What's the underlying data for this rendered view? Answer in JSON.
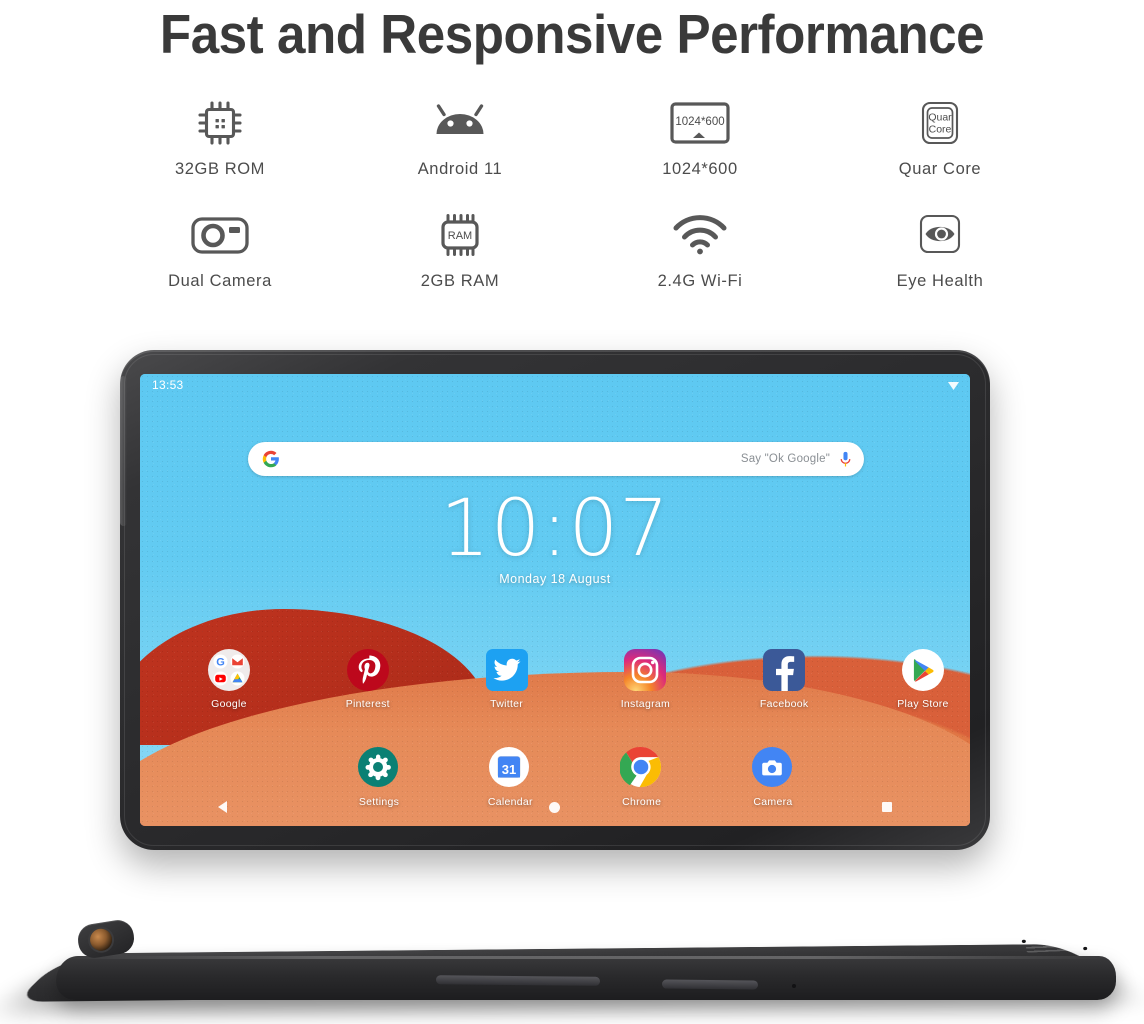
{
  "headline": "Fast and Responsive Performance",
  "features": [
    {
      "icon": "cpu-chip-icon",
      "label": "32GB ROM"
    },
    {
      "icon": "android-robot-icon",
      "label": "Android 11"
    },
    {
      "icon": "display-resolution-icon",
      "label": "1024*600",
      "icon_text": "1024*600"
    },
    {
      "icon": "quad-core-icon",
      "label": "Quar Core",
      "icon_text_line1": "Quar",
      "icon_text_line2": "Core"
    },
    {
      "icon": "camera-icon",
      "label": "Dual Camera"
    },
    {
      "icon": "ram-chip-icon",
      "label": "2GB RAM",
      "icon_text": "RAM"
    },
    {
      "icon": "wifi-icon",
      "label": "2.4G Wi-Fi"
    },
    {
      "icon": "eye-icon",
      "label": "Eye Health"
    }
  ],
  "tablet": {
    "statusbar": {
      "time": "13:53"
    },
    "search": {
      "hint": "Say \"Ok Google\""
    },
    "clock_widget": {
      "time": "10:07",
      "date": "Monday 18 August"
    },
    "apps_row1": [
      {
        "name": "Google",
        "icon": "google-folder-icon"
      },
      {
        "name": "Pinterest",
        "icon": "pinterest-icon"
      },
      {
        "name": "Twitter",
        "icon": "twitter-icon"
      },
      {
        "name": "Instagram",
        "icon": "instagram-icon"
      },
      {
        "name": "Facebook",
        "icon": "facebook-icon"
      },
      {
        "name": "Play Store",
        "icon": "play-store-icon"
      }
    ],
    "dock": [
      {
        "name": "Settings",
        "icon": "settings-gear-icon"
      },
      {
        "name": "Calendar",
        "icon": "calendar-icon",
        "day": "31"
      },
      {
        "name": "Chrome",
        "icon": "chrome-icon"
      },
      {
        "name": "Camera",
        "icon": "camera-app-icon"
      }
    ],
    "nav": [
      {
        "name": "back",
        "icon": "back-triangle-icon"
      },
      {
        "name": "home",
        "icon": "home-circle-icon"
      },
      {
        "name": "recents",
        "icon": "recents-square-icon"
      }
    ]
  },
  "colors": {
    "headline": "#3a3a3a",
    "icon_gray": "#4c4c4c",
    "sky": "#5ec9f2",
    "dune_red": "#c0341f",
    "dune_orange": "#e07a4a",
    "bezel": "#2b2b2d",
    "white": "#ffffff"
  }
}
